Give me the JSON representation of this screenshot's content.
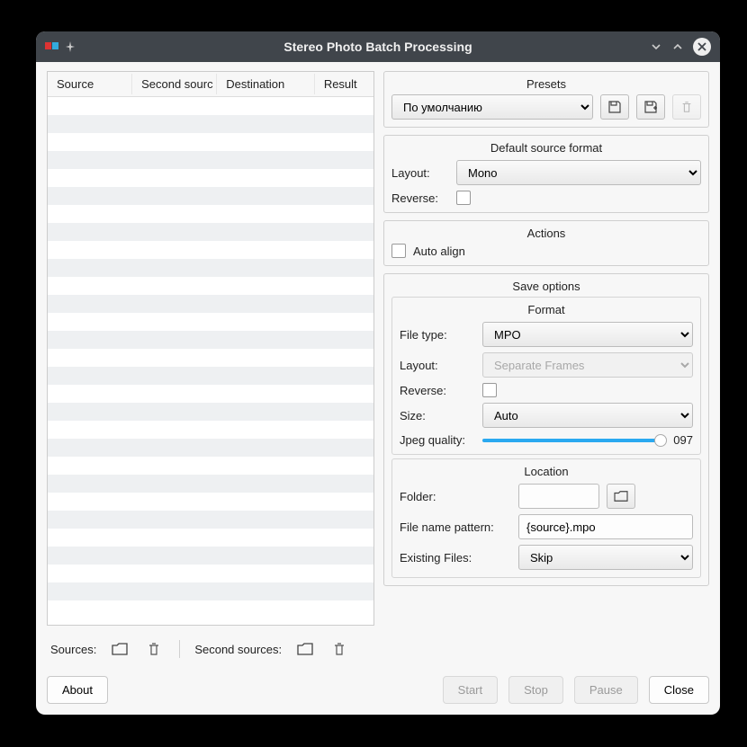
{
  "window": {
    "title": "Stereo Photo Batch Processing"
  },
  "table": {
    "headers": {
      "source": "Source",
      "second": "Second sourc",
      "dest": "Destination",
      "result": "Result"
    },
    "row_count": 28
  },
  "sources_bar": {
    "sources_label": "Sources:",
    "second_sources_label": "Second sources:"
  },
  "buttons": {
    "about": "About",
    "start": "Start",
    "stop": "Stop",
    "pause": "Pause",
    "close": "Close"
  },
  "presets": {
    "title": "Presets",
    "selected": "По умолчанию"
  },
  "default_source_format": {
    "title": "Default source format",
    "layout_label": "Layout:",
    "layout_value": "Mono",
    "reverse_label": "Reverse:",
    "reverse_checked": false
  },
  "actions": {
    "title": "Actions",
    "auto_align_label": "Auto align",
    "auto_align_checked": false
  },
  "save_options": {
    "title": "Save options",
    "format": {
      "title": "Format",
      "file_type_label": "File type:",
      "file_type_value": "MPO",
      "layout_label": "Layout:",
      "layout_value": "Separate Frames",
      "reverse_label": "Reverse:",
      "reverse_checked": false,
      "size_label": "Size:",
      "size_value": "Auto",
      "jpeg_quality_label": "Jpeg quality:",
      "jpeg_quality_value": "097",
      "jpeg_quality_pct": 97
    },
    "location": {
      "title": "Location",
      "folder_label": "Folder:",
      "folder_value": "",
      "pattern_label": "File name pattern:",
      "pattern_value": "{source}.mpo",
      "existing_label": "Existing Files:",
      "existing_value": "Skip"
    }
  }
}
